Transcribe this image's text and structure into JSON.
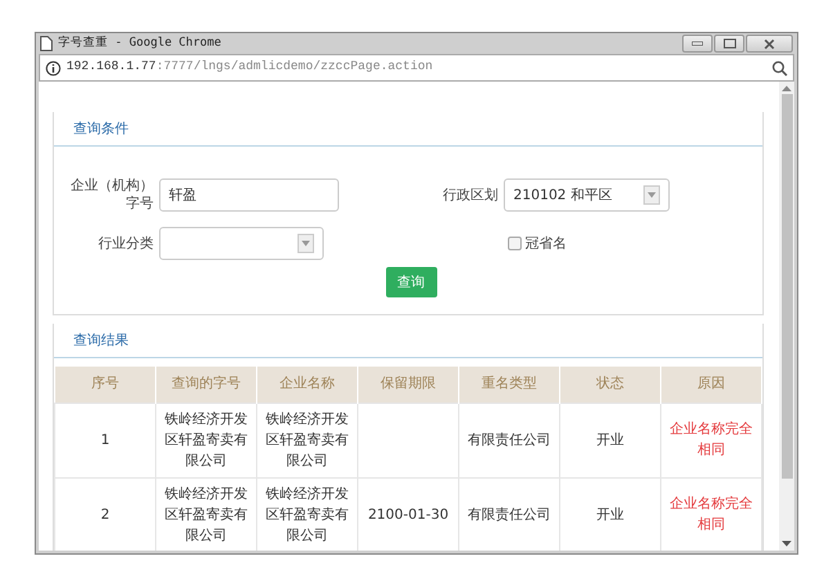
{
  "window": {
    "title": "字号查重 - Google Chrome",
    "url_host": "192.168.1.77",
    "url_path": ":7777/lngs/admlicdemo/zzccPage.action"
  },
  "query_panel": {
    "title": "查询条件",
    "fields": [
      {
        "kind": "text",
        "label": "企业（机构）字号",
        "value": "轩盈"
      },
      {
        "kind": "select",
        "label": "行政区划",
        "value": "210102 和平区"
      },
      {
        "kind": "select",
        "label": "行业分类"
      },
      {
        "kind": "checkbox",
        "label": "冠省名",
        "checked": false
      }
    ],
    "button": "查询"
  },
  "results_panel": {
    "title": "查询结果",
    "table": {
      "columns": [
        "序号",
        "查询的字号",
        "企业名称",
        "保留期限",
        "重名类型",
        "状态",
        "原因"
      ],
      "rows": [
        {
          "cells": [
            "1",
            "铁岭经济开发区轩盈寄卖有限公司",
            "铁岭经济开发区轩盈寄卖有限公司",
            null,
            "有限责任公司",
            "开业",
            "企业名称完全相同"
          ]
        },
        {
          "cells": [
            "2",
            "铁岭经济开发区轩盈寄卖有限公司",
            "铁岭经济开发区轩盈寄卖有限公司",
            "2100-01-30",
            "有限责任公司",
            "开业",
            "企业名称完全相同"
          ]
        }
      ]
    }
  }
}
